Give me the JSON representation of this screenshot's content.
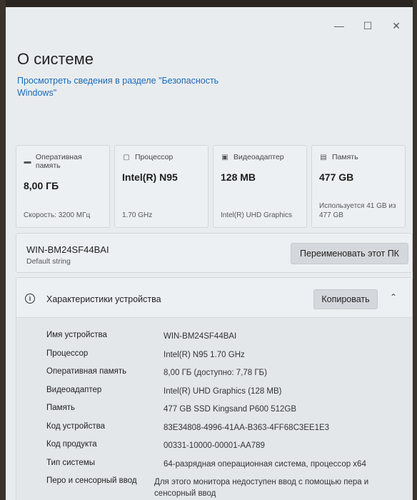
{
  "window": {
    "controls": [
      "—",
      "☐",
      "✕"
    ]
  },
  "page_title": "О системе",
  "security_link": "Просмотреть сведения в разделе \"Безопасность Windows\"",
  "cards": [
    {
      "icon": "memory-icon",
      "glyph": "▬",
      "label": "Оперативная память",
      "value": "8,00 ГБ",
      "detail": "Скорость: 3200 МГц"
    },
    {
      "icon": "processor-icon",
      "glyph": "▢",
      "label": "Процессор",
      "value": "Intel(R) N95",
      "detail": "1.70 GHz"
    },
    {
      "icon": "display-adapter-icon",
      "glyph": "▣",
      "label": "Видеоадаптер",
      "value": "128 MB",
      "detail": "Intel(R) UHD Graphics"
    },
    {
      "icon": "storage-icon",
      "glyph": "▤",
      "label": "Память",
      "value": "477 GB",
      "detail": "Используется 41 GB из 477 GB"
    }
  ],
  "pc": {
    "name": "WIN-BM24SF44BAI",
    "subtitle": "Default string",
    "rename_label": "Переименовать этот ПК"
  },
  "specs": {
    "title": "Характеристики устройства",
    "copy_label": "Копировать",
    "rows": [
      {
        "key": "Имя устройства",
        "value": "WIN-BM24SF44BAI"
      },
      {
        "key": "Процессор",
        "value": "Intel(R) N95   1.70 GHz"
      },
      {
        "key": "Оперативная память",
        "value": "8,00 ГБ (доступно: 7,78 ГБ)"
      },
      {
        "key": "Видеоадаптер",
        "value": "Intel(R) UHD Graphics (128 MB)"
      },
      {
        "key": "Память",
        "value": "477 GB SSD Kingsand P600 512GB"
      },
      {
        "key": "Код устройства",
        "value": "83E34808-4996-41AA-B363-4FF68C3EE1E3"
      },
      {
        "key": "Код продукта",
        "value": "00331-10000-00001-AA789"
      },
      {
        "key": "Тип системы",
        "value": "64-разрядная операционная система, процессор x64"
      },
      {
        "key": "Перо и сенсорный ввод",
        "value": "Для этого монитора недоступен ввод с помощью пера и сенсорный ввод"
      }
    ]
  }
}
